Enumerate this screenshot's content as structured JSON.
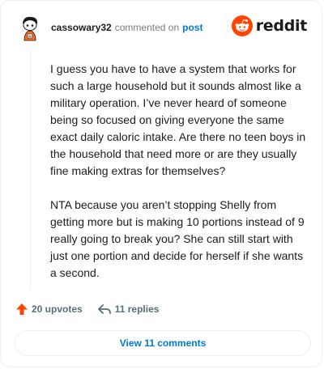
{
  "comment": {
    "username": "cassowary32",
    "action": "commented on",
    "target_link": "post",
    "paragraphs": [
      "I guess you have to have a system that works for such a large household but it sounds almost like a military operation. I’ve never heard of someone being so focused on giving everyone the same exact daily caloric intake. Are there no teen boys in the household that need more or are they usually fine making extras for themselves?",
      "NTA because you aren’t stopping Shelly from getting more but is making 10 portions instead of 9 really going to break you? She can still start with just one portion and decide for herself if she wants a second."
    ]
  },
  "brand": {
    "name": "reddit",
    "color": "#ff4500"
  },
  "footer": {
    "upvotes_label": "20 upvotes",
    "replies_label": "11 replies",
    "upvote_color": "#ff4500"
  },
  "view_button": {
    "label": "View 11 comments"
  },
  "colors": {
    "link": "#0079d3",
    "muted": "#7c7c7c",
    "border": "#edeff1"
  }
}
